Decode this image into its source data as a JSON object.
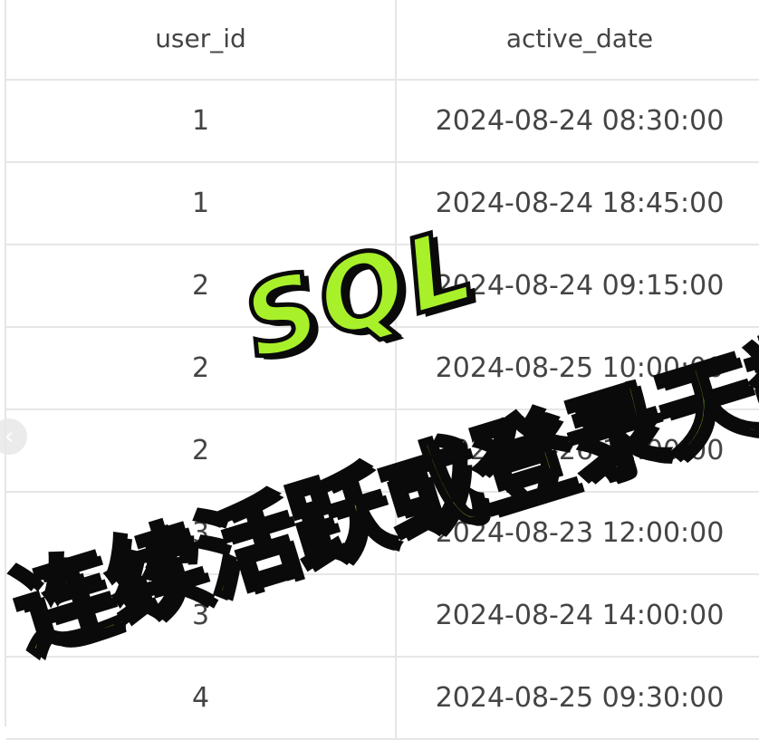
{
  "table": {
    "headers": [
      "user_id",
      "active_date"
    ],
    "rows": [
      [
        "1",
        "2024-08-24 08:30:00"
      ],
      [
        "1",
        "2024-08-24 18:45:00"
      ],
      [
        "2",
        "2024-08-24 09:15:00"
      ],
      [
        "2",
        "2024-08-25 10:00:00"
      ],
      [
        "2",
        "2024-08-26 11:00:00"
      ],
      [
        "3",
        "2024-08-23 12:00:00"
      ],
      [
        "3",
        "2024-08-24 14:00:00"
      ],
      [
        "4",
        "2024-08-25 09:30:00"
      ]
    ]
  },
  "overlay": {
    "sql": "SQL",
    "title": "连续活跃或登录天数"
  },
  "colors": {
    "overlay_fill": "#a8f02a",
    "overlay_stroke": "#0a0a0a",
    "grid": "#e6e6e6",
    "text": "#444444"
  },
  "icons": {
    "back": "chevron-left-icon"
  }
}
